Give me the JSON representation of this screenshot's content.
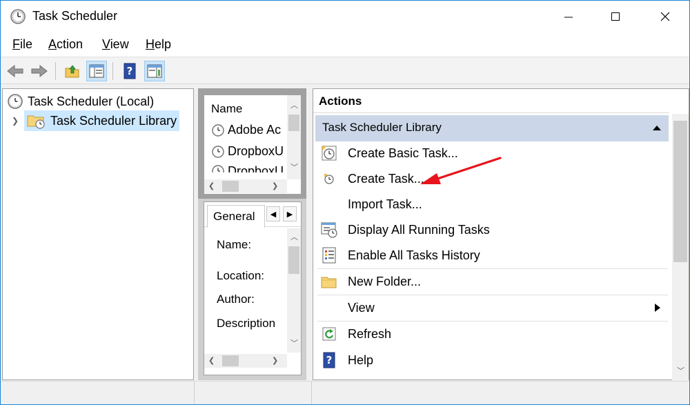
{
  "window": {
    "title": "Task Scheduler"
  },
  "menu": {
    "items": [
      {
        "label": "File",
        "accel": "F",
        "rest": "ile"
      },
      {
        "label": "Action",
        "accel": "A",
        "rest": "ction"
      },
      {
        "label": "View",
        "accel": "V",
        "rest": "iew"
      },
      {
        "label": "Help",
        "accel": "H",
        "rest": "elp"
      }
    ]
  },
  "tree": {
    "root": "Task Scheduler (Local)",
    "child": "Task Scheduler Library"
  },
  "task_list": {
    "column": "Name",
    "items": [
      "Adobe Ac",
      "DropboxU",
      "DropboxU"
    ]
  },
  "details": {
    "tab": "General",
    "labels": [
      "Name:",
      "Location:",
      "Author:",
      "Description"
    ]
  },
  "actions": {
    "title": "Actions",
    "section": "Task Scheduler Library",
    "items": [
      {
        "label": "Create Basic Task...",
        "icon": "create-basic-task-icon"
      },
      {
        "label": "Create Task...",
        "icon": "create-task-icon"
      },
      {
        "label": "Import Task...",
        "icon": ""
      },
      {
        "label": "Display All Running Tasks",
        "icon": "running-tasks-icon"
      },
      {
        "label": "Enable All Tasks History",
        "icon": "tasks-history-icon"
      },
      {
        "label": "New Folder...",
        "icon": "new-folder-icon"
      },
      {
        "label": "View",
        "icon": ""
      },
      {
        "label": "Refresh",
        "icon": "refresh-icon"
      },
      {
        "label": "Help",
        "icon": "help-icon"
      }
    ]
  },
  "colors": {
    "accent": "#1883d7",
    "selection": "#cce8ff",
    "section_header": "#cbd7e8",
    "annotation_arrow": "#e8141c"
  }
}
